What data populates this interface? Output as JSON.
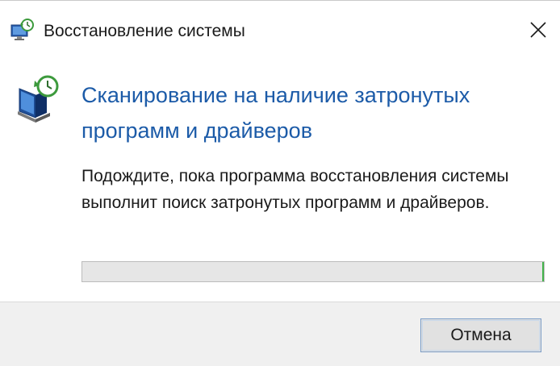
{
  "window": {
    "title": "Восстановление системы",
    "icon": "system-restore-icon",
    "close_icon": "close-icon"
  },
  "main": {
    "icon": "system-restore-monitor-icon",
    "heading": "Сканирование на наличие затронутых программ и драйверов",
    "description": "Подождите, пока программа восстановления системы выполнит поиск затронутых программ и драйверов.",
    "progress": 0
  },
  "footer": {
    "cancel_label": "Отмена"
  },
  "colors": {
    "heading": "#1c5ba8",
    "progress_track": "#e6e6e6",
    "progress_accent": "#43b24a",
    "button_border": "#7a9cc6"
  }
}
